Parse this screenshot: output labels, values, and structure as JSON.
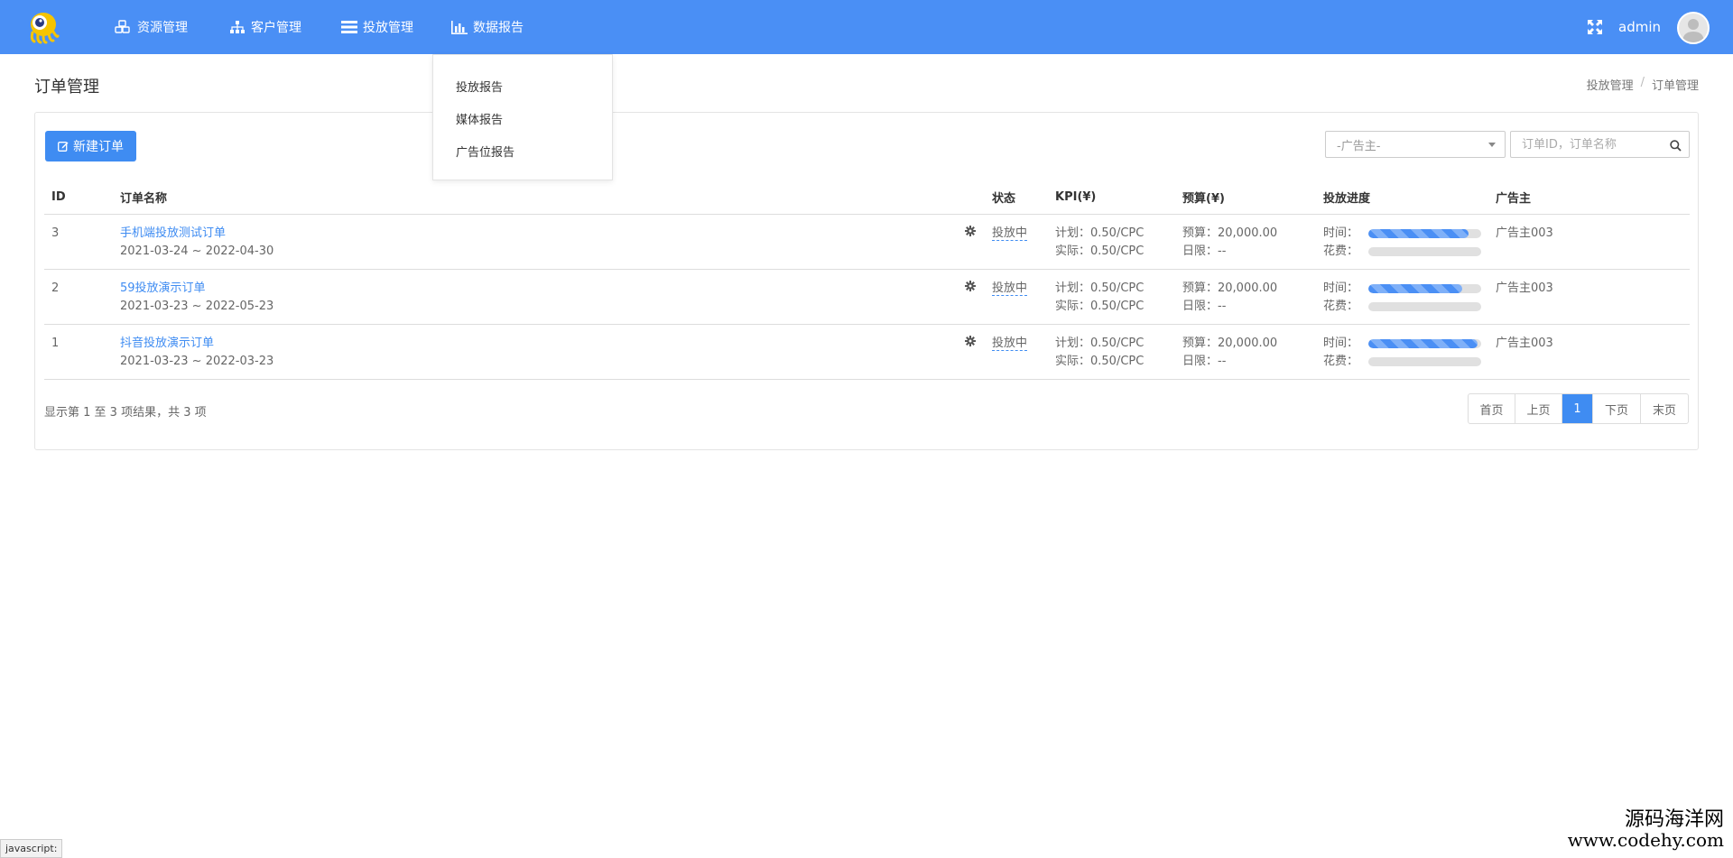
{
  "nav": {
    "items": [
      {
        "label": "资源管理",
        "icon": "cubes-icon"
      },
      {
        "label": "客户管理",
        "icon": "sitemap-icon"
      },
      {
        "label": "投放管理",
        "icon": "list-icon"
      },
      {
        "label": "数据报告",
        "icon": "bar-chart-icon"
      }
    ],
    "fullscreen_icon": "expand-icon",
    "username": "admin"
  },
  "dropdown": {
    "items": [
      "投放报告",
      "媒体报告",
      "广告位报告"
    ]
  },
  "page": {
    "title": "订单管理",
    "breadcrumb": [
      "投放管理",
      "/",
      "订单管理"
    ]
  },
  "toolbar": {
    "new_button": "新建订单",
    "advertiser_select": "-广告主-",
    "search_placeholder": "订单ID，订单名称"
  },
  "table": {
    "headers": [
      "ID",
      "订单名称",
      "",
      "状态",
      "KPI(¥)",
      "预算(¥)",
      "投放进度",
      "广告主"
    ],
    "rows": [
      {
        "id": "3",
        "name": "手机端投放测试订单",
        "dates": "2021-03-24 ~ 2022-04-30",
        "status": "投放中",
        "kpi_plan": "计划：0.50/CPC",
        "kpi_actual": "实际：0.50/CPC",
        "budget": "预算：20,000.00",
        "daily_limit": "日限：--",
        "time_label": "时间：",
        "spend_label": "花费：",
        "time_progress": 0.89,
        "spend_progress": 0,
        "advertiser": "广告主003"
      },
      {
        "id": "2",
        "name": "59投放演示订单",
        "dates": "2021-03-23 ~ 2022-05-23",
        "status": "投放中",
        "kpi_plan": "计划：0.50/CPC",
        "kpi_actual": "实际：0.50/CPC",
        "budget": "预算：20,000.00",
        "daily_limit": "日限：--",
        "time_label": "时间：",
        "spend_label": "花费：",
        "time_progress": 0.83,
        "spend_progress": 0,
        "advertiser": "广告主003"
      },
      {
        "id": "1",
        "name": "抖音投放演示订单",
        "dates": "2021-03-23 ~ 2022-03-23",
        "status": "投放中",
        "kpi_plan": "计划：0.50/CPC",
        "kpi_actual": "实际：0.50/CPC",
        "budget": "预算：20,000.00",
        "daily_limit": "日限：--",
        "time_label": "时间：",
        "spend_label": "花费：",
        "time_progress": 0.97,
        "spend_progress": 0,
        "advertiser": "广告主003"
      }
    ]
  },
  "footer": {
    "summary": "显示第 1 至 3 项结果，共 3 项",
    "pager": [
      "首页",
      "上页",
      "1",
      "下页",
      "末页"
    ],
    "active_page": "1"
  },
  "status_bar": "javascript:",
  "watermark": {
    "line1": "源码海洋网",
    "line2": "www.codehy.com"
  },
  "colors": {
    "navbar": "#4a8ff5",
    "primary": "#3f8cf2"
  }
}
